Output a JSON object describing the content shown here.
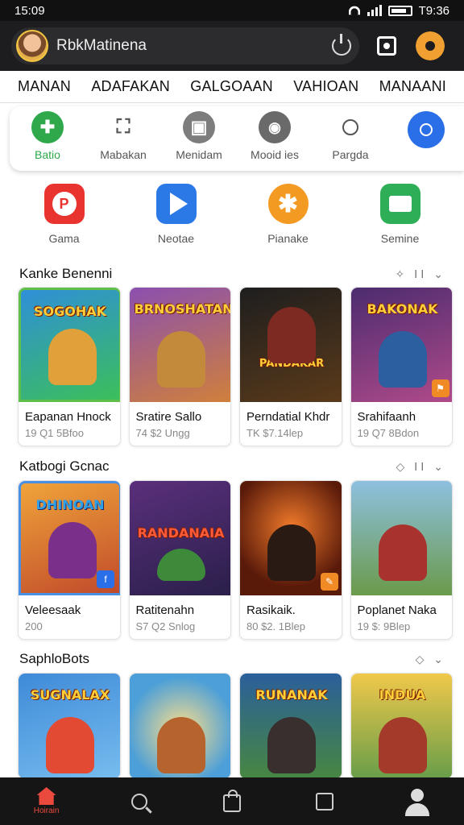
{
  "status_bar": {
    "time_left": "15:09",
    "time_right": "T9:36"
  },
  "header": {
    "search_text": "RbkMatinena"
  },
  "tabs": [
    "MANAN",
    "ADAFAKAN",
    "GALGOAAN",
    "VAHIOAN",
    "MANAANI"
  ],
  "quick_actions": [
    {
      "label": "Batio",
      "color": "#2ea84a",
      "icon": "+"
    },
    {
      "label": "Mabakan",
      "color": "#ffffff",
      "icon": ""
    },
    {
      "label": "Menidam",
      "color": "#7d7d7d",
      "icon": ""
    },
    {
      "label": "Mooid ies",
      "color": "#6a6a6a",
      "icon": ""
    },
    {
      "label": "Pargda",
      "color": "#ffffff",
      "icon": ""
    },
    {
      "label": "",
      "color": "#2b6fe8",
      "icon": ""
    }
  ],
  "apps": [
    {
      "label": "Gama",
      "color": "#e8332f"
    },
    {
      "label": "Neotae",
      "color": "#2b79e6"
    },
    {
      "label": "Pianake",
      "color": "#f39a22"
    },
    {
      "label": "Semine",
      "color": "#2fae58"
    }
  ],
  "sections": [
    {
      "title": "Kanke Benenni",
      "controls": "✧ ⅠⅠ ⌄",
      "cards": [
        {
          "art_title": "SOGOHAK",
          "name": "Eapanan Hnock",
          "meta": "19 Q1 5Bfoo",
          "bg": "#2f8fd8",
          "hero": "#e0a13b",
          "border": "#5fbf4a"
        },
        {
          "art_title": "BRNOSHATAN",
          "name": "Sratire Sallo",
          "meta": "74 $2 Ungg",
          "bg": "#8a4fb0",
          "hero": "#c48a3c",
          "border": "#e3e3e3"
        },
        {
          "art_title": "PANDAKAR",
          "name": "Perndatial Khdr",
          "meta": "TK $7.14lep",
          "bg": "#2a2a2a",
          "hero": "#7d2a22",
          "border": "#e3e3e3"
        },
        {
          "art_title": "BAKONAK",
          "name": "Srahifaanh",
          "meta": "19 Q7 8Bdon",
          "bg": "#4b2c6f",
          "hero": "#2b5fa0",
          "border": "#e3e3e3"
        }
      ]
    },
    {
      "title": "Katbogi Gcnac",
      "controls": "◇ ⅠⅠ ⌄",
      "cards": [
        {
          "art_title": "DHINOAN",
          "name": "Veleesaak",
          "meta": "200",
          "bg": "#3b74c8",
          "hero": "#7a2f8a",
          "border": "#4a90e2"
        },
        {
          "art_title": "RANDANAIA",
          "name": "Ratitenahn",
          "meta": "S7 Q2 Snlog",
          "bg": "#5a2f7c",
          "hero": "#3d8a3b",
          "border": "#e3e3e3"
        },
        {
          "art_title": "",
          "name": "Rasikaik.",
          "meta": "80 $2. 1Blep",
          "bg": "#c0421f",
          "hero": "#2a1a14",
          "border": "#e3e3e3"
        },
        {
          "art_title": "",
          "name": "Poplanet Naka",
          "meta": "19 $: 9Blep",
          "bg": "#6aa0c8",
          "hero": "#a8322e",
          "border": "#e3e3e3"
        }
      ]
    },
    {
      "title": "SaphloBots",
      "controls": "◇ ⌄",
      "cards": [
        {
          "art_title": "SUGNALAX",
          "name": "",
          "meta": "",
          "bg": "#3f8ad8",
          "hero": "#e24a34",
          "border": "#e3e3e3"
        },
        {
          "art_title": "",
          "name": "",
          "meta": "",
          "bg": "#4c9fd8",
          "hero": "#b7632d",
          "border": "#e3e3e3"
        },
        {
          "art_title": "RUNANAK",
          "name": "",
          "meta": "",
          "bg": "#2a5f9a",
          "hero": "#3a2f2f",
          "border": "#e3e3e3"
        },
        {
          "art_title": "INDUA",
          "name": "",
          "meta": "",
          "bg": "#5c9a4a",
          "hero": "#a33a2a",
          "border": "#e3e3e3"
        }
      ]
    }
  ],
  "bottom_nav": {
    "home_label": "Hoirain"
  }
}
